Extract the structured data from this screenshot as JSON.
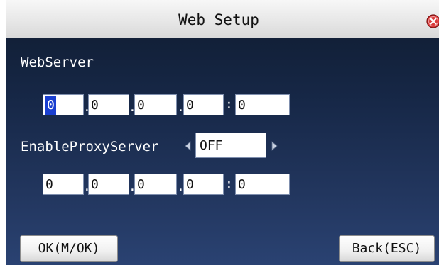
{
  "window": {
    "title": "Web Setup",
    "close_icon": "close-icon"
  },
  "web_server": {
    "label": "WebServer",
    "octets": [
      "0",
      "0",
      "0",
      "0"
    ],
    "port": "0",
    "selected_value": "0"
  },
  "proxy": {
    "label": "EnableProxyServer",
    "value": "OFF",
    "octets": [
      "0",
      "0",
      "0",
      "0"
    ],
    "port": "0"
  },
  "separators": {
    "dot": ".",
    "colon": ":"
  },
  "buttons": {
    "ok": "OK(M/OK)",
    "back": "Back(ESC)"
  },
  "colors": {
    "background_top": "#0f1c30",
    "background_bottom": "#2a4272",
    "selection": "#1a3fd0",
    "close_icon": "#d83a3a"
  }
}
